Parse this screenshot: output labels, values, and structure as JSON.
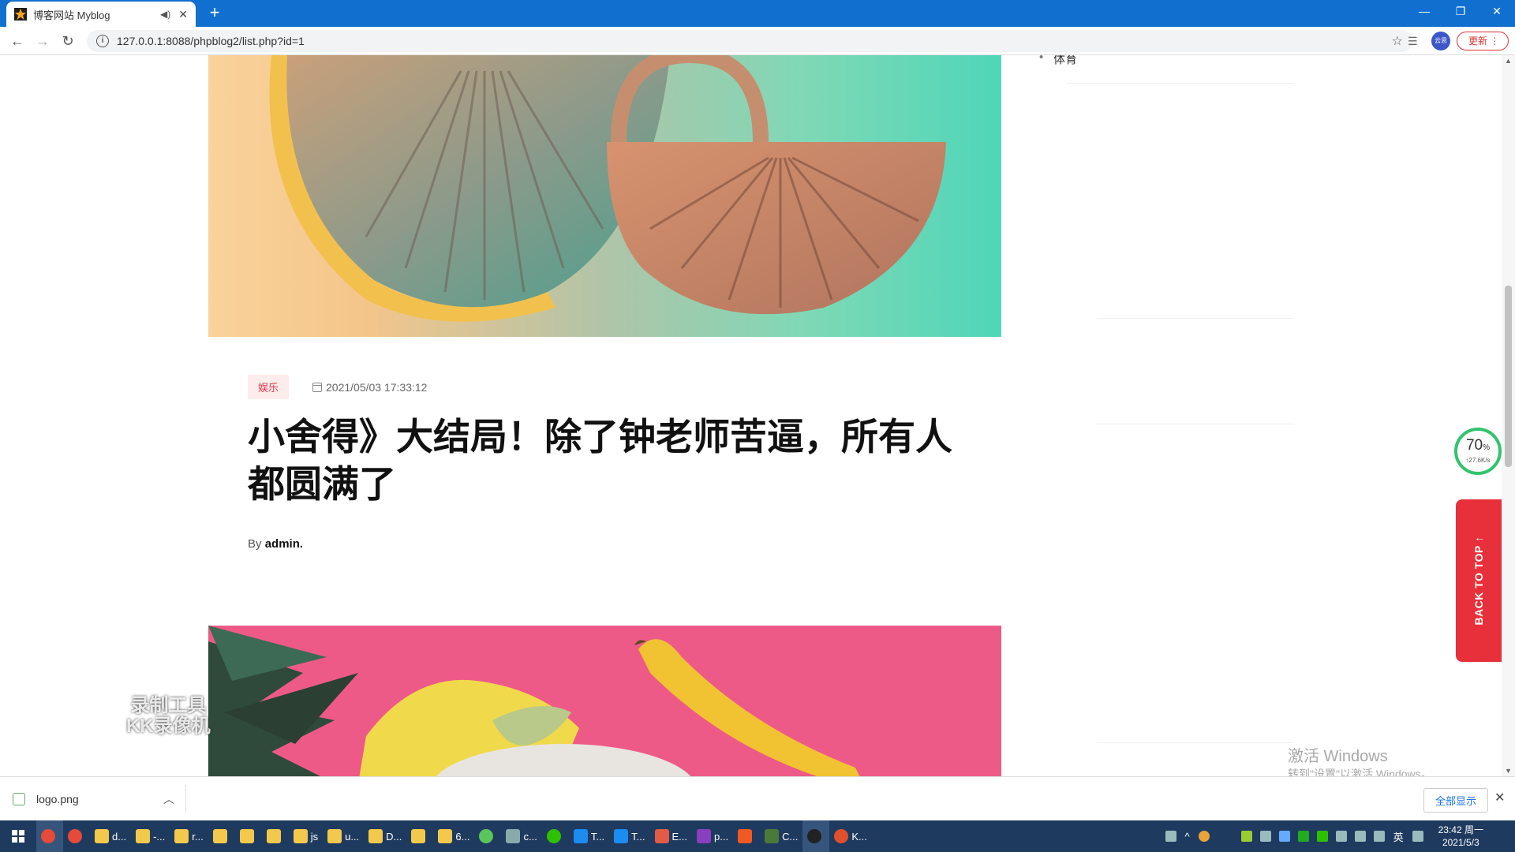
{
  "browser": {
    "tab_title": "博客网站 Myblog",
    "url": "127.0.0.1:8088/phpblog2/list.php?id=1",
    "avatar_text": "云思",
    "update_label": "更新"
  },
  "post": {
    "category": "娱乐",
    "date": "2021/05/03 17:33:12",
    "title": "小舍得》大结局！除了钟老师苦逼，所有人都圆满了",
    "by_label": "By",
    "author": "admin."
  },
  "sidebar": {
    "item": "体育"
  },
  "widgets": {
    "gauge_value": "70",
    "gauge_unit": "%",
    "gauge_speed": "↑27.6K/s",
    "back_to_top": "BACK TO TOP ↑",
    "watermark_line1": "录制工具",
    "watermark_line2": "KK录像机",
    "activate_line1": "激活 Windows",
    "activate_line2": "转到\"设置\"以激活 Windows。"
  },
  "download": {
    "file_name": "logo.png",
    "show_all": "全部显示"
  },
  "taskbar": {
    "items": [
      "d...",
      "-...",
      "r...",
      "js",
      "u...",
      "D...",
      "6...",
      "c...",
      "T...",
      "T...",
      "E...",
      "p...",
      "C...",
      "K..."
    ],
    "ime": "英",
    "time": "23:42 周一",
    "date": "2021/5/3"
  },
  "colors": {
    "accent": "#1170cf",
    "back_to_top": "#e8303a",
    "category": "#e0364b"
  }
}
